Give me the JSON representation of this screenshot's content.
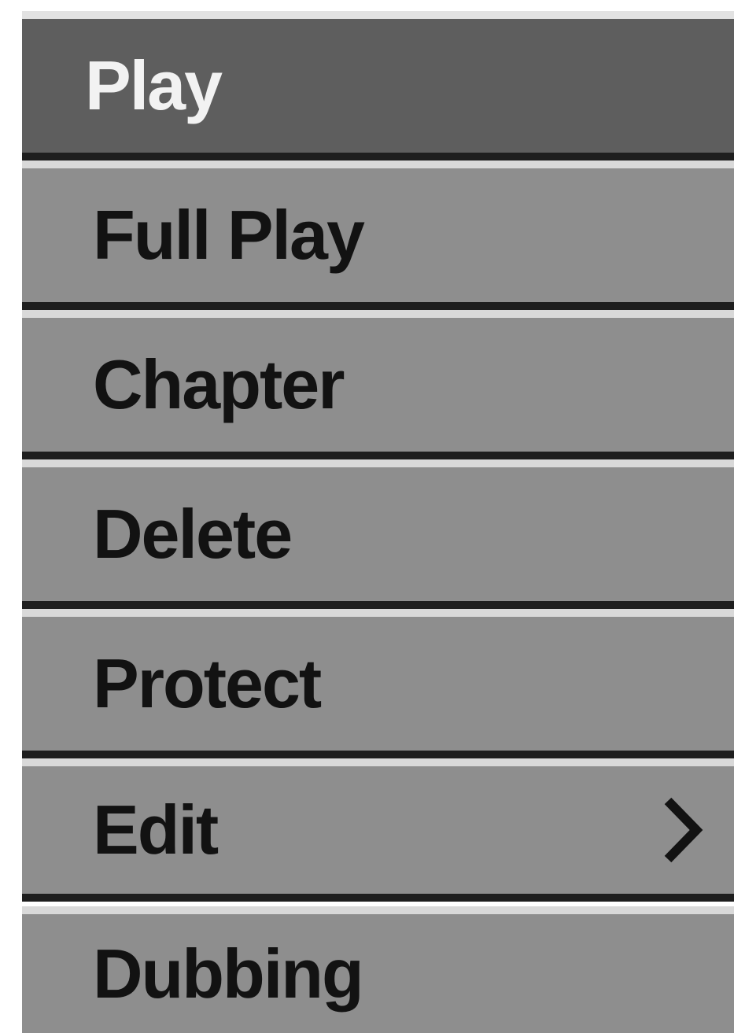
{
  "menu": {
    "items": [
      {
        "label": "Play",
        "selected": true
      },
      {
        "label": "Full Play"
      },
      {
        "label": "Chapter"
      },
      {
        "label": "Delete"
      },
      {
        "label": "Protect"
      },
      {
        "label": "Edit",
        "submenu_icon": "chevron-right-icon"
      },
      {
        "label": "Dubbing"
      }
    ]
  },
  "colors": {
    "item_background": "#8e8e8e",
    "selected_background": "#5e5e5e",
    "text": "#121212",
    "selected_text": "#f2f2f2"
  }
}
